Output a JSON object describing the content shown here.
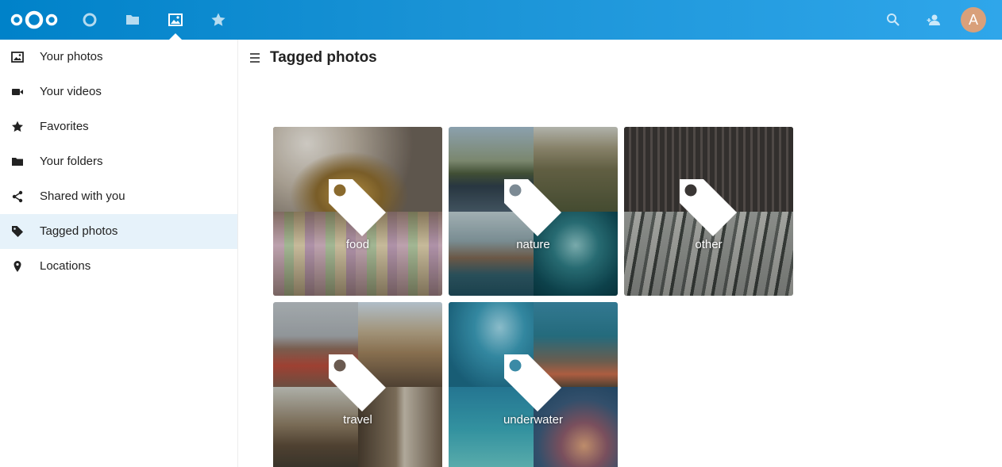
{
  "header": {
    "apps": [
      {
        "name": "dashboard",
        "icon": "circle-icon"
      },
      {
        "name": "files",
        "icon": "folder-icon"
      },
      {
        "name": "photos",
        "icon": "image-icon",
        "active": true
      },
      {
        "name": "activity",
        "icon": "star-icon"
      }
    ],
    "avatar_initial": "A",
    "accent": "#0082c9"
  },
  "sidebar": {
    "items": [
      {
        "label": "Your photos",
        "icon": "image-icon"
      },
      {
        "label": "Your videos",
        "icon": "video-icon"
      },
      {
        "label": "Favorites",
        "icon": "star-icon"
      },
      {
        "label": "Your folders",
        "icon": "folder-icon"
      },
      {
        "label": "Shared with you",
        "icon": "share-icon"
      },
      {
        "label": "Tagged photos",
        "icon": "tag-icon",
        "active": true
      },
      {
        "label": "Locations",
        "icon": "location-pin-icon"
      }
    ]
  },
  "main": {
    "title": "Tagged photos",
    "tags": [
      {
        "label": "food"
      },
      {
        "label": "nature"
      },
      {
        "label": "other"
      },
      {
        "label": "travel"
      },
      {
        "label": "underwater"
      }
    ]
  }
}
